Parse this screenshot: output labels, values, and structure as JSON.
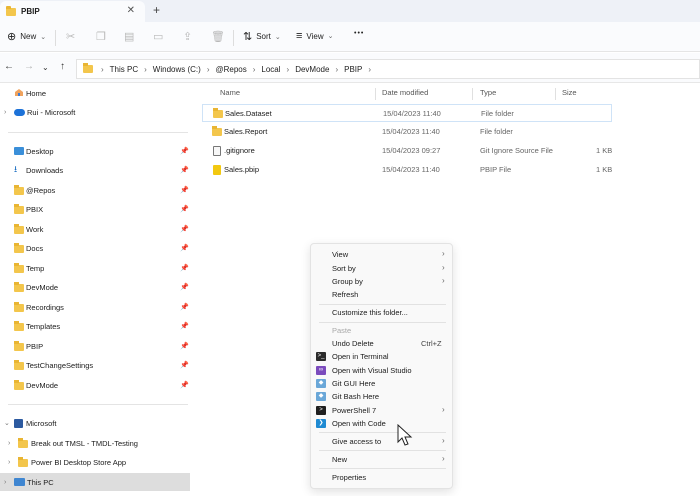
{
  "tab": {
    "title": "PBIP",
    "close": "✕",
    "new_tab": "+"
  },
  "toolbar": {
    "new_label": "New",
    "sort_label": "Sort",
    "view_label": "View",
    "more": "•••"
  },
  "address": {
    "crumbs": [
      "This PC",
      "Windows (C:)",
      "@Repos",
      "Local",
      "DevMode",
      "PBIP"
    ]
  },
  "sidebar": {
    "top": [
      {
        "label": "Home",
        "icon": "home-icon"
      },
      {
        "label": "Rui - Microsoft",
        "icon": "cloud-icon"
      }
    ],
    "pinned": [
      {
        "label": "Desktop",
        "icon": "desktop-icon"
      },
      {
        "label": "Downloads",
        "icon": "download-icon"
      },
      {
        "label": "@Repos",
        "icon": "folder-icon"
      },
      {
        "label": "PBIX",
        "icon": "folder-icon"
      },
      {
        "label": "Work",
        "icon": "folder-icon"
      },
      {
        "label": "Docs",
        "icon": "folder-icon"
      },
      {
        "label": "Temp",
        "icon": "folder-icon"
      },
      {
        "label": "DevMode",
        "icon": "folder-icon"
      },
      {
        "label": "Recordings",
        "icon": "folder-icon"
      },
      {
        "label": "Templates",
        "icon": "folder-icon"
      },
      {
        "label": "PBIP",
        "icon": "folder-icon"
      },
      {
        "label": "TestChangeSettings",
        "icon": "folder-icon"
      },
      {
        "label": "DevMode",
        "icon": "folder-icon"
      }
    ],
    "bottom": [
      {
        "label": "Microsoft",
        "icon": "microsoft-icon"
      },
      {
        "label": "Break out TMSL - TMDL-Testing",
        "icon": "folder-icon"
      },
      {
        "label": "Power BI Desktop Store App",
        "icon": "folder-icon"
      },
      {
        "label": "This PC",
        "icon": "pc-icon"
      }
    ]
  },
  "columns": {
    "name": "Name",
    "date": "Date modified",
    "type": "Type",
    "size": "Size"
  },
  "files": [
    {
      "name": "Sales.Dataset",
      "date": "15/04/2023 11:40",
      "type": "File folder",
      "size": ""
    },
    {
      "name": "Sales.Report",
      "date": "15/04/2023 11:40",
      "type": "File folder",
      "size": ""
    },
    {
      "name": ".gitignore",
      "date": "15/04/2023 09:27",
      "type": "Git Ignore Source File",
      "size": "1 KB"
    },
    {
      "name": "Sales.pbip",
      "date": "15/04/2023 11:40",
      "type": "PBIP File",
      "size": "1 KB"
    }
  ],
  "menu": {
    "items": [
      {
        "label": "View",
        "arrow": "›"
      },
      {
        "label": "Sort by",
        "arrow": "›"
      },
      {
        "label": "Group by",
        "arrow": "›"
      },
      {
        "label": "Refresh"
      },
      {
        "label": "Customize this folder..."
      },
      {
        "label": "Paste"
      },
      {
        "label": "Undo Delete",
        "shortcut": "Ctrl+Z"
      },
      {
        "label": "Open in Terminal"
      },
      {
        "label": "Open with Visual Studio"
      },
      {
        "label": "Git GUI Here"
      },
      {
        "label": "Git Bash Here"
      },
      {
        "label": "PowerShell 7",
        "arrow": "›"
      },
      {
        "label": "Open with Code"
      },
      {
        "label": "Give access to",
        "arrow": "›"
      },
      {
        "label": "New",
        "arrow": "›"
      },
      {
        "label": "Properties"
      }
    ]
  },
  "colors": {
    "folder": "#f3c64c",
    "accent": "#1d72d8",
    "selection": "#dddddd"
  }
}
